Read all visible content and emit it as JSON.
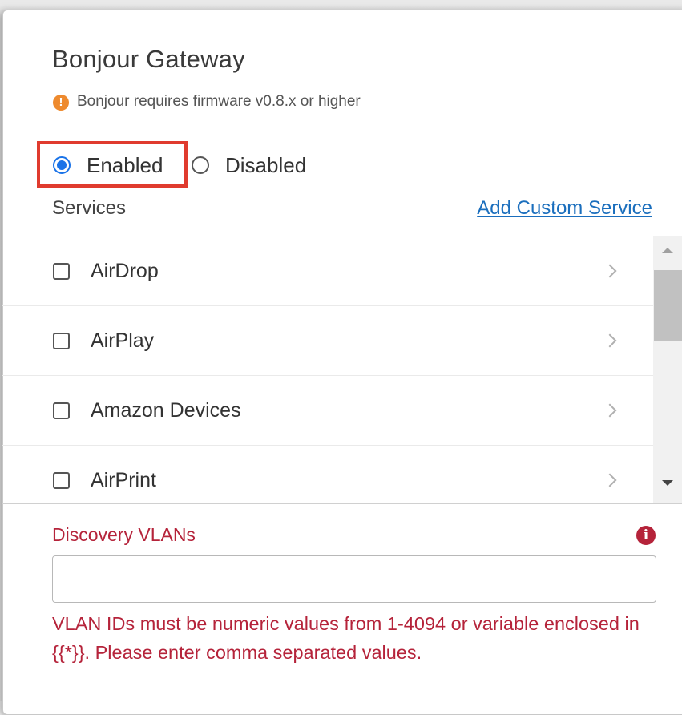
{
  "panel": {
    "title": "Bonjour Gateway",
    "firmware_warning": "Bonjour requires firmware v0.8.x or higher",
    "warning_icon": "exclamation-circle-icon",
    "warning_color": "#ee8a2e"
  },
  "mode": {
    "selected": "Enabled",
    "options": [
      {
        "label": "Enabled",
        "checked": true
      },
      {
        "label": "Disabled",
        "checked": false
      }
    ],
    "accent_color": "#1a73e8",
    "highlight_color": "#e03b2e"
  },
  "services": {
    "label": "Services",
    "add_custom_link": "Add Custom Service",
    "items": [
      {
        "label": "AirDrop",
        "checked": false
      },
      {
        "label": "AirPlay",
        "checked": false
      },
      {
        "label": "Amazon Devices",
        "checked": false
      },
      {
        "label": "AirPrint",
        "checked": false
      }
    ]
  },
  "discovery_vlans": {
    "label": "Discovery VLANs",
    "value": "",
    "placeholder": "",
    "error": "VLAN IDs must be numeric values from 1-4094 or variable enclosed in {{*}}. Please enter comma separated values.",
    "error_color": "#b5233a",
    "info_icon": "info-circle-icon"
  }
}
